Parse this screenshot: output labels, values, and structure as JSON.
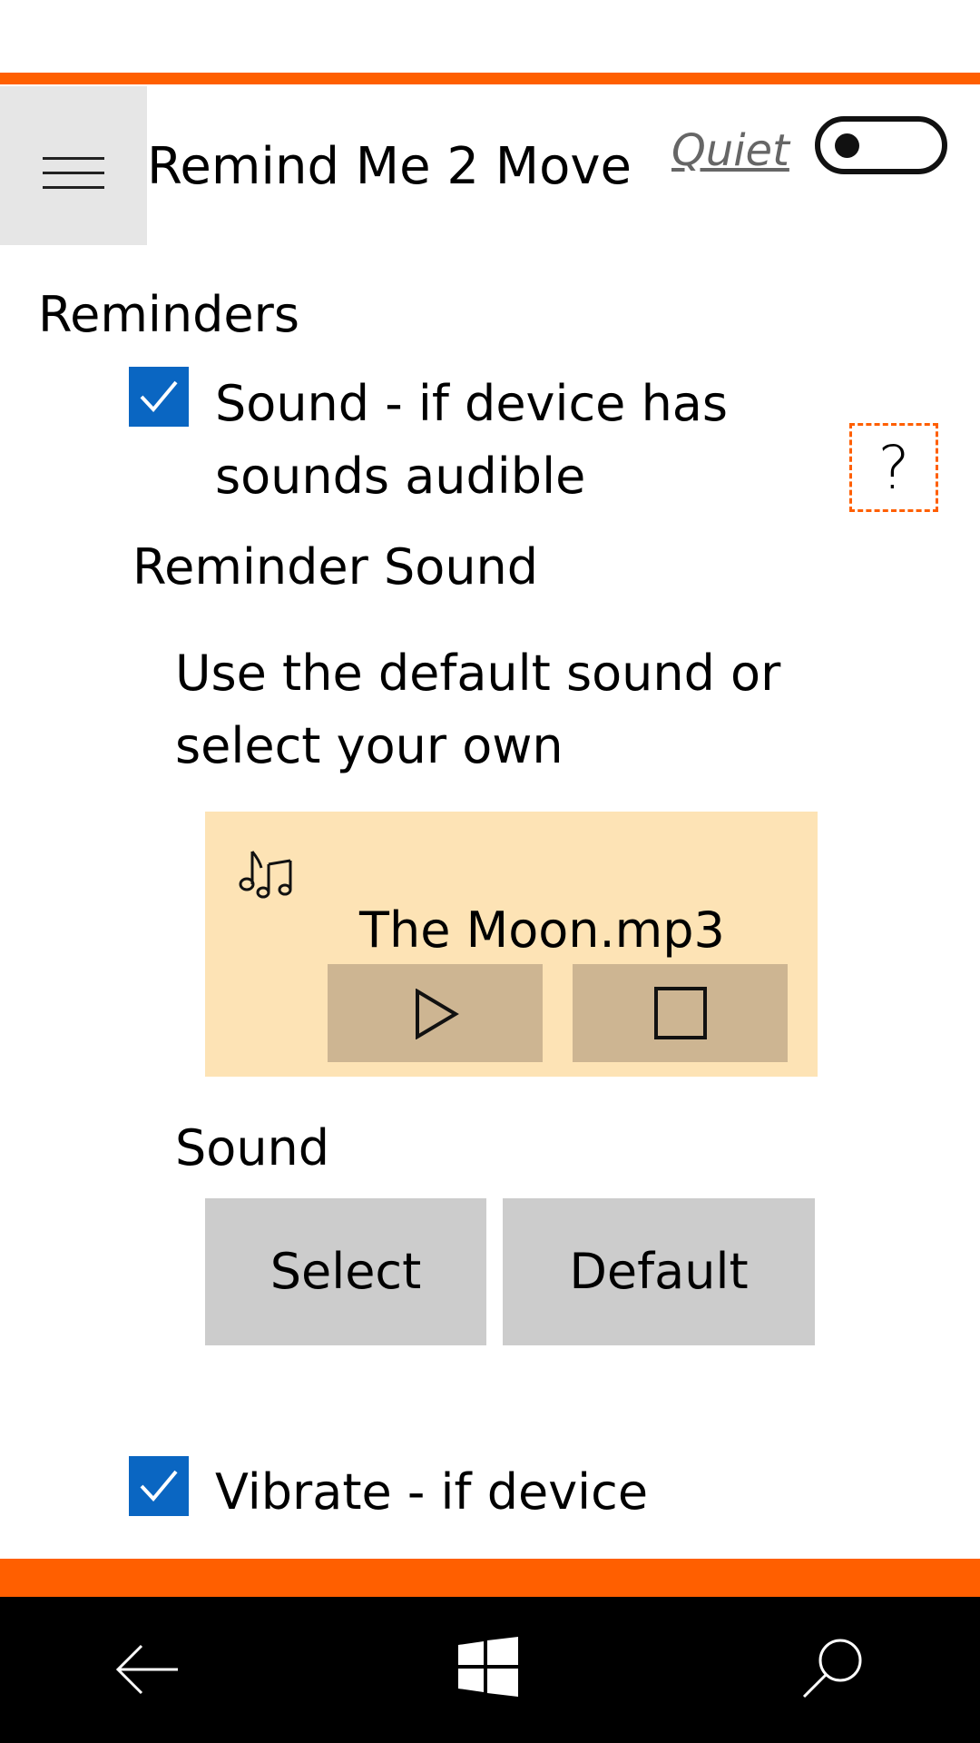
{
  "app": {
    "title": "Remind Me 2 Move",
    "quiet_label": "Quiet",
    "quiet_toggle_on": false
  },
  "colors": {
    "accent": "#ff5f00",
    "checkbox": "#0a66c2",
    "card": "#fde3b5",
    "card_button": "#cdb592",
    "button": "#cccccc"
  },
  "reminders": {
    "heading": "Reminders",
    "sound_checkbox": {
      "checked": true,
      "label_line1": "Sound - if device has",
      "label_line2": "sounds audible"
    },
    "help_label": "?",
    "reminder_sound_heading": "Reminder Sound",
    "description_line1": "Use the default sound or",
    "description_line2": "select your own",
    "current_sound": {
      "icon": "music-notes-icon",
      "file_name": "The Moon.mp3",
      "play_icon": "play-icon",
      "stop_icon": "stop-icon"
    },
    "sound_section_label": "Sound",
    "select_button": "Select",
    "default_button": "Default",
    "vibrate_checkbox": {
      "checked": true,
      "label_line1": "Vibrate - if device"
    }
  },
  "navbar": {
    "back_icon": "back-arrow-icon",
    "home_icon": "windows-logo-icon",
    "search_icon": "search-icon"
  }
}
